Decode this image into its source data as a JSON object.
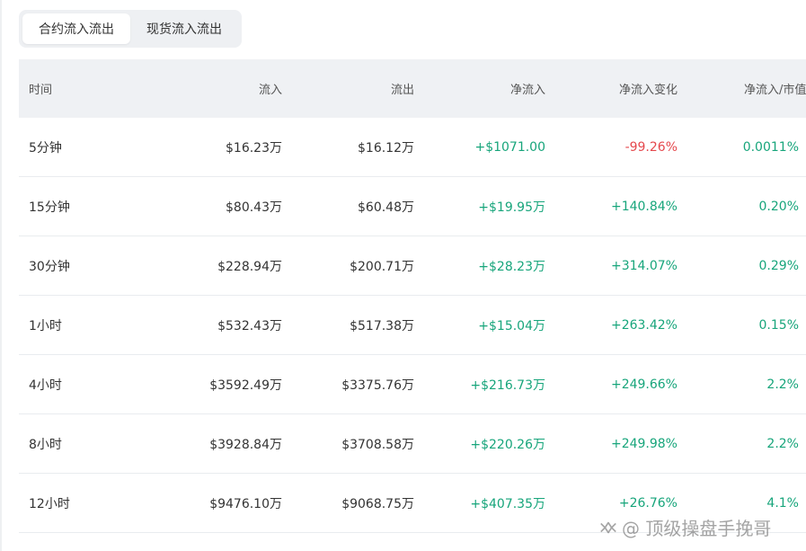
{
  "tabs": [
    {
      "label": "合约流入流出",
      "active": true
    },
    {
      "label": "现货流入流出",
      "active": false
    }
  ],
  "table": {
    "headers": [
      "时间",
      "流入",
      "流出",
      "净流入",
      "净流入变化",
      "净流入/市值"
    ],
    "rows": [
      [
        "5分钟",
        "$16.23万",
        "$16.12万",
        "+$1071.00",
        "-99.26%",
        "0.0011%"
      ],
      [
        "15分钟",
        "$80.43万",
        "$60.48万",
        "+$19.95万",
        "+140.84%",
        "0.20%"
      ],
      [
        "30分钟",
        "$228.94万",
        "$200.71万",
        "+$28.23万",
        "+314.07%",
        "0.29%"
      ],
      [
        "1小时",
        "$532.43万",
        "$517.38万",
        "+$15.04万",
        "+263.42%",
        "0.15%"
      ],
      [
        "4小时",
        "$3592.49万",
        "$3375.76万",
        "+$216.73万",
        "+249.66%",
        "2.2%"
      ],
      [
        "8小时",
        "$3928.84万",
        "$3708.58万",
        "+$220.26万",
        "+249.98%",
        "2.2%"
      ],
      [
        "12小时",
        "$9476.10万",
        "$9068.75万",
        "+$407.35万",
        "+26.76%",
        "4.1%"
      ]
    ]
  },
  "colors": {
    "positive": "#17a57b",
    "negative": "#e5484d",
    "header_bg": "#eff1f4",
    "tab_bg": "#eef0f3"
  },
  "watermark": {
    "text": "@ 顶级操盘手挽哥",
    "icon": "wechat-channels-icon"
  }
}
